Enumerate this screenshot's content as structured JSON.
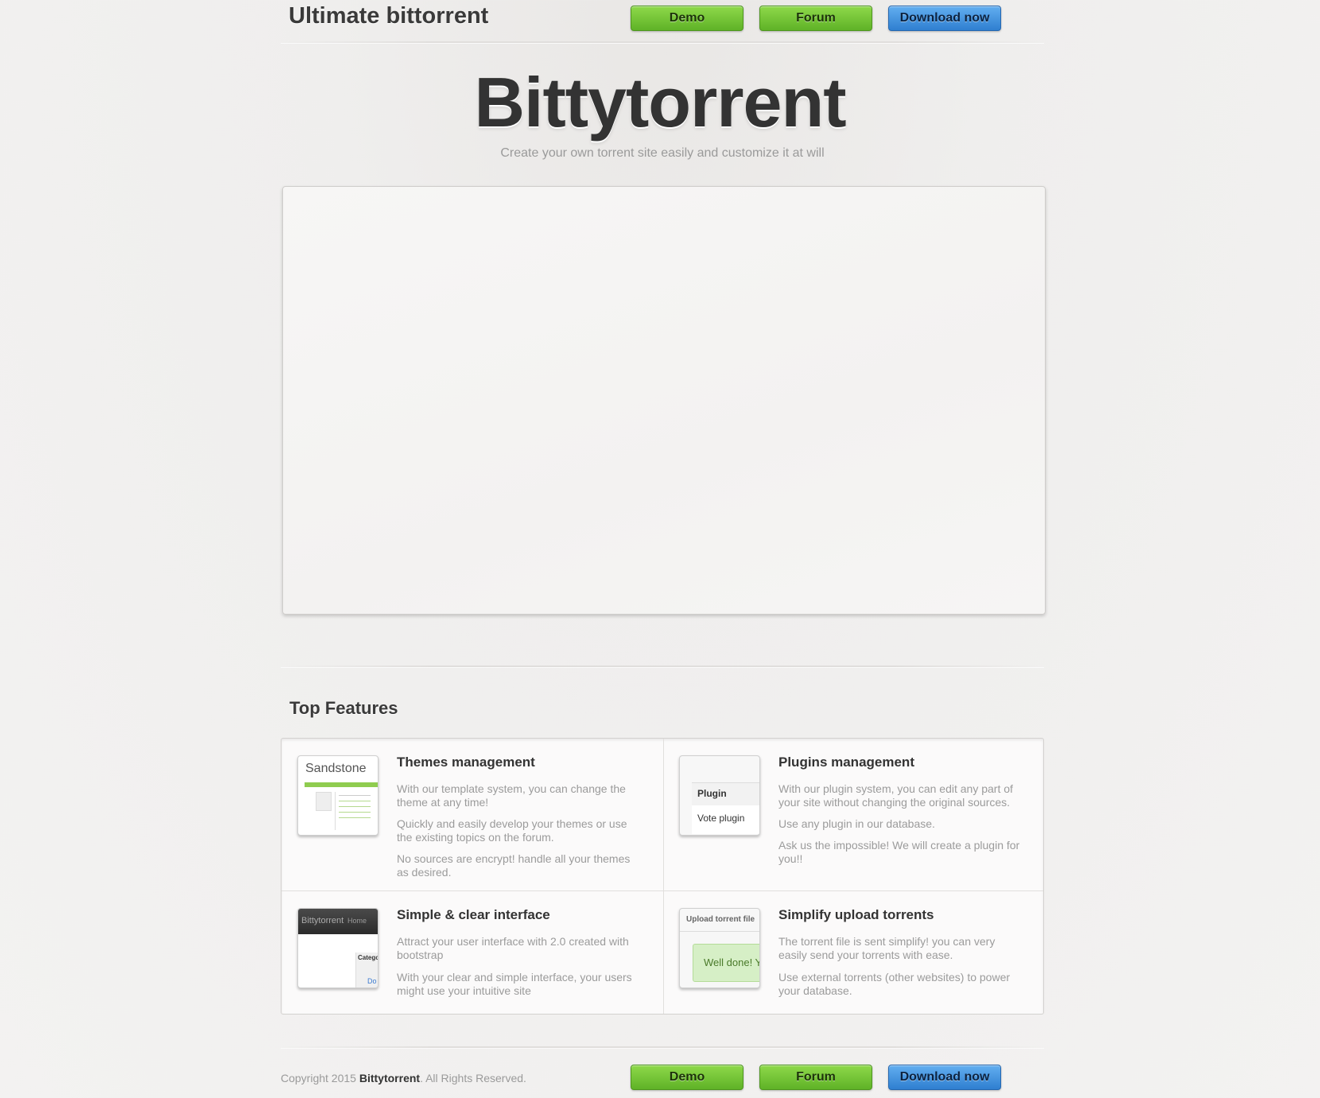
{
  "header": {
    "brand": "Ultimate bittorrent",
    "nav": {
      "demo": "Demo",
      "forum": "Forum",
      "download": "Download now"
    }
  },
  "hero": {
    "title": "Bittytorrent",
    "subtitle": "Create your own torrent site easily and customize it at will"
  },
  "features": {
    "title": "Top Features",
    "items": [
      {
        "title": "Themes management",
        "thumb_label": "Sandstone",
        "paragraphs": [
          "With our template system, you can change the theme at any time!",
          "Quickly and easily develop your themes or use the existing topics on the forum.",
          "No sources are encrypt! handle all your themes as desired."
        ]
      },
      {
        "title": "Plugins management",
        "thumb_rows": [
          "Plugin",
          "Vote plugin"
        ],
        "paragraphs": [
          "With our plugin system, you can edit any part of your site without changing the original sources.",
          "Use any plugin in our database.",
          "Ask us the impossible! We will create a plugin for you!!"
        ]
      },
      {
        "title": "Simple & clear interface",
        "thumb_brand": "Bittytorrent",
        "thumb_nav": "Home",
        "thumb_side": "Categori",
        "thumb_link": "Do",
        "paragraphs": [
          "Attract your user interface with 2.0 created with bootstrap",
          "With your clear and simple interface, your users might use your intuitive site"
        ]
      },
      {
        "title": "Simplify upload torrents",
        "thumb_head": "Upload torrent file",
        "thumb_alert": "Well done! Yo",
        "paragraphs": [
          "The torrent file is sent simplify! you can very easily send your torrents with ease.",
          "Use external torrents (other websites) to power your database."
        ]
      }
    ]
  },
  "footer": {
    "copy_prefix": "Copyright 2015",
    "copy_brand": "Bittytorrent",
    "copy_suffix": ". All Rights Reserved.",
    "nav": {
      "demo": "Demo",
      "forum": "Forum",
      "download": "Download now"
    }
  },
  "colors": {
    "green_button": "#6cc232",
    "blue_button": "#3a8ede",
    "background": "#efeeed",
    "muted_text": "#9b9b9b"
  }
}
